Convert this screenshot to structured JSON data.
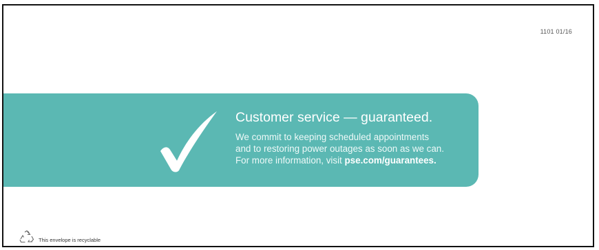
{
  "envelope": {
    "form_code": "1101 01/16",
    "recycle_text": "This envelope is recyclable",
    "recycle_icon": "recycle-icon"
  },
  "banner": {
    "icon": "checkmark-icon",
    "headline": "Customer service — guaranteed.",
    "line1": "We commit to keeping scheduled appointments",
    "line2": "and to restoring power outages as soon as we can.",
    "line3_prefix": "For more information, visit ",
    "line3_link": "pse.com/guarantees.",
    "color": "#5bb8b3"
  }
}
